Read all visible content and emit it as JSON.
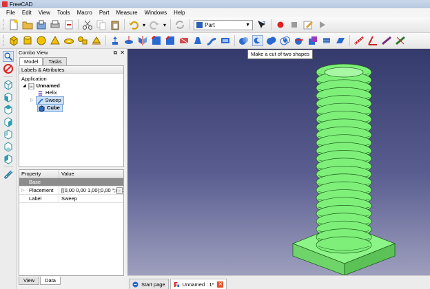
{
  "window": {
    "title": "FreeCAD"
  },
  "menubar": {
    "items": [
      "File",
      "Edit",
      "View",
      "Tools",
      "Macro",
      "Part",
      "Measure",
      "Windows",
      "Help"
    ]
  },
  "toolbar": {
    "workbench": "Part"
  },
  "tooltip": "Make a cut of two shapes",
  "combo": {
    "title": "Combo View",
    "tabs": [
      "Model",
      "Tasks"
    ],
    "tree_header": "Labels & Attributes",
    "tree": {
      "root": "Application",
      "document": "Unnamed",
      "items": [
        "Helix",
        "Sweep",
        "Cube"
      ]
    },
    "properties": {
      "header": [
        "Property",
        "Value"
      ],
      "group": "Base",
      "rows": [
        {
          "name": "Placement",
          "value": "[(0,00 0,00 1,00);0,00 °;(0,0",
          "expand": "▷"
        },
        {
          "name": "Label",
          "value": "Sweep"
        }
      ]
    },
    "bottom_tabs": [
      "View",
      "Data"
    ]
  },
  "doc_tabs": [
    {
      "label": "Start page"
    },
    {
      "label": "Unnamed : 1*"
    }
  ],
  "colors": {
    "shape": "#7ef07a",
    "edge": "#1f5e1c",
    "bg_top": "#353a6c",
    "bg_bottom": "#9e9fbe"
  }
}
